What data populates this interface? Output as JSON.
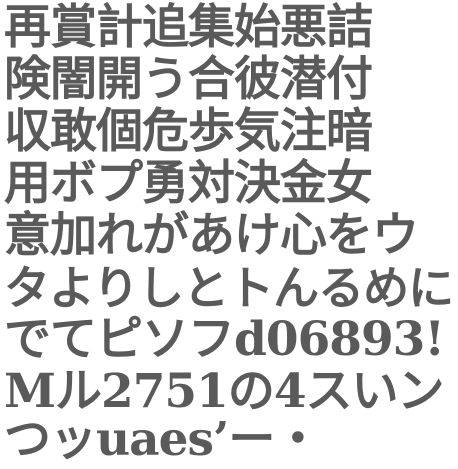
{
  "ink_color": "#5a5a5a",
  "rows": [
    "再賞計追集始悪詰",
    "険闇開う合彼潜付",
    "収敢個危歩気注暗",
    "用ボプ勇対決金女",
    "意加れがあけ心をウ",
    "タよりしとトんるめに",
    "でてピソフd06893!",
    "Mル2751の4スいン",
    "つッuaes’ー・"
  ]
}
